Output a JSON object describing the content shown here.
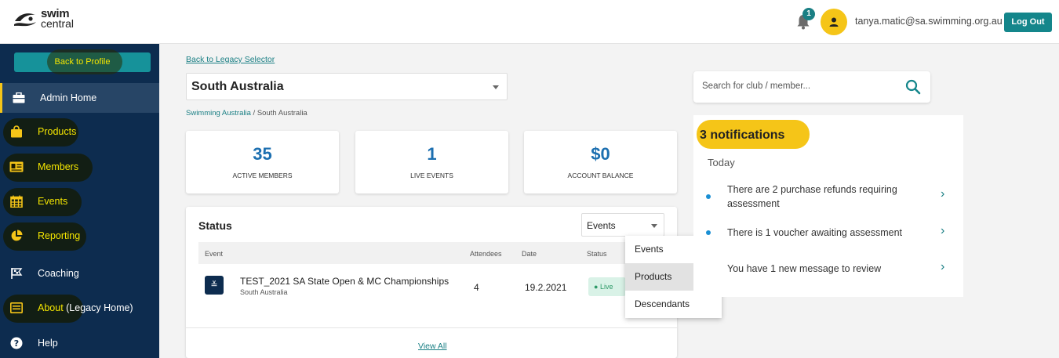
{
  "header": {
    "logo_line1": "swim",
    "logo_line2": "central",
    "notification_count": "1",
    "user_email": "tanya.matic@sa.swimming.org.au",
    "logout_label": "Log Out"
  },
  "sidebar": {
    "back_label": "Back to Profile",
    "items": [
      {
        "label": "Admin Home",
        "icon": "briefcase-icon"
      },
      {
        "label": "Products",
        "icon": "shopping-bag-icon"
      },
      {
        "label": "Members",
        "icon": "id-card-icon"
      },
      {
        "label": "Events",
        "icon": "calendar-icon"
      },
      {
        "label": "Reporting",
        "icon": "pie-chart-icon"
      },
      {
        "label": "Coaching",
        "icon": "flag-icon"
      },
      {
        "label": "About",
        "label_suffix": " (Legacy Home)",
        "icon": "id-badge-icon"
      },
      {
        "label": "Help",
        "icon": "help-icon"
      }
    ]
  },
  "main": {
    "legacy_link": "Back to Legacy Selector",
    "org_select_value": "South Australia",
    "breadcrumb": {
      "root": "Swimming Australia",
      "sep": "/",
      "current": "South Australia"
    },
    "stats": [
      {
        "value": "35",
        "label": "ACTIVE MEMBERS"
      },
      {
        "value": "1",
        "label": "LIVE EVENTS"
      },
      {
        "value": "$0",
        "label": "ACCOUNT BALANCE"
      }
    ],
    "status": {
      "title": "Status",
      "filter_value": "Events",
      "columns": [
        "Event",
        "Attendees",
        "Date",
        "Status"
      ],
      "rows": [
        {
          "name": "TEST_2021 SA State Open & MC Championships",
          "sub": "South Australia",
          "attendees": "4",
          "date": "19.2.2021",
          "status": "Live"
        }
      ],
      "view_all": "View All"
    },
    "filter_options": [
      "Events",
      "Products",
      "Descendants"
    ],
    "filter_highlighted": "Products"
  },
  "right": {
    "search_placeholder": "Search for club / member...",
    "notifications": {
      "title": "3 notifications",
      "group": "Today",
      "items": [
        "There are 2 purchase refunds requiring assessment",
        "There is 1 voucher awaiting assessment",
        "You have 1 new message to review"
      ]
    }
  },
  "colors": {
    "sidebar": "#0d2c4f",
    "accent_teal": "#14868b",
    "highlight_yellow": "#f5c518",
    "stat_blue": "#1c6fb0"
  }
}
